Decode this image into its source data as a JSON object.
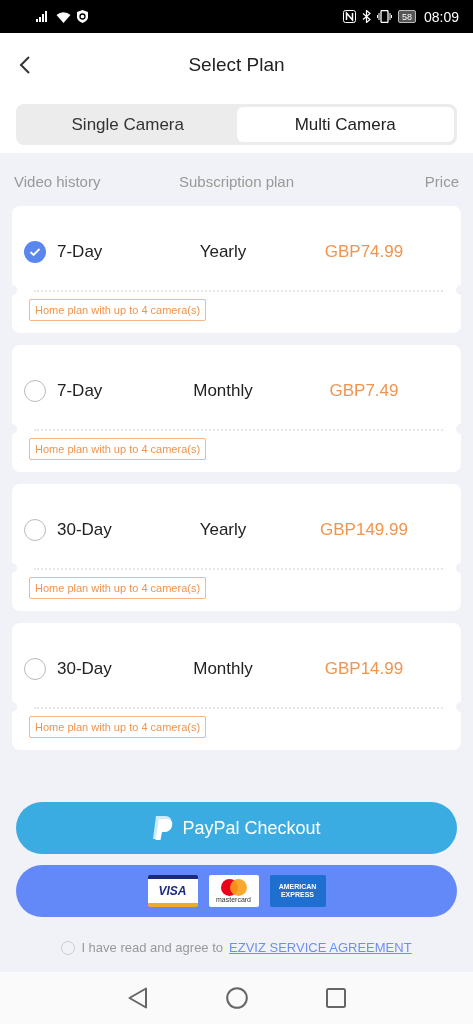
{
  "status_bar": {
    "battery": "58",
    "time": "08:09"
  },
  "header": {
    "title": "Select Plan"
  },
  "tabs": [
    {
      "label": "Single Camera",
      "selected": false
    },
    {
      "label": "Multi Camera",
      "selected": true
    }
  ],
  "columns": [
    "Video history",
    "Subscription plan",
    "Price"
  ],
  "plans": [
    {
      "video_history": "7-Day",
      "subscription": "Yearly",
      "price": "GBP74.99",
      "tag": "Home plan with up to 4 camera(s)",
      "selected": true
    },
    {
      "video_history": "7-Day",
      "subscription": "Monthly",
      "price": "GBP7.49",
      "tag": "Home plan with up to 4 camera(s)",
      "selected": false
    },
    {
      "video_history": "30-Day",
      "subscription": "Yearly",
      "price": "GBP149.99",
      "tag": "Home plan with up to 4 camera(s)",
      "selected": false
    },
    {
      "video_history": "30-Day",
      "subscription": "Monthly",
      "price": "GBP14.99",
      "tag": "Home plan with up to 4 camera(s)",
      "selected": false
    }
  ],
  "paypal_button": {
    "label": "PayPal Checkout"
  },
  "card_button": {
    "logos": [
      {
        "kind": "visa",
        "text": "VISA"
      },
      {
        "kind": "mastercard",
        "text": "mastercard"
      },
      {
        "kind": "amex",
        "text": "AMERICAN EXPRESS"
      }
    ]
  },
  "agreement": {
    "checked": false,
    "text": "I have read and agree to",
    "link": "EZVIZ SERVICE AGREEMENT"
  }
}
